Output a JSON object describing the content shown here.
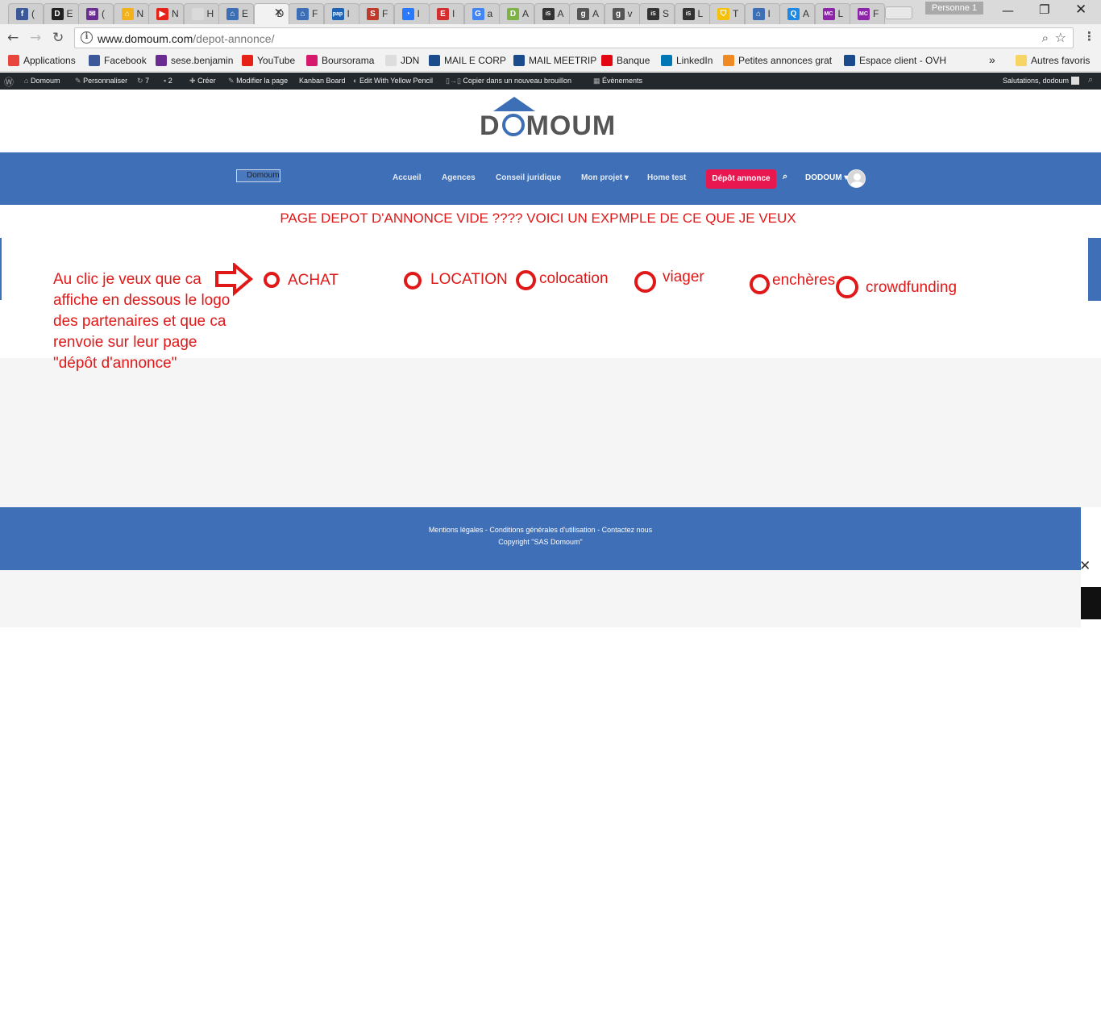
{
  "browser": {
    "tabs": [
      {
        "fav": "f",
        "color": "#3b5998",
        "label": "("
      },
      {
        "fav": "D",
        "color": "#222222",
        "label": "E"
      },
      {
        "fav": "✉",
        "color": "#6a2c91",
        "label": "("
      },
      {
        "fav": "⌂",
        "color": "#f3b21b",
        "label": "N"
      },
      {
        "fav": "▶",
        "color": "#e62117",
        "label": "N"
      },
      {
        "fav": "",
        "color": "#dadada",
        "label": "H"
      },
      {
        "fav": "⌂",
        "color": "#3c6fb6",
        "label": "E"
      },
      {
        "fav": "",
        "color": "#f2f2f2",
        "label": "D"
      },
      {
        "fav": "⌂",
        "color": "#3c6fb6",
        "label": "F"
      },
      {
        "fav": "pap",
        "color": "#1f63b5",
        "label": "I"
      },
      {
        "fav": "S",
        "color": "#c0392b",
        "label": "F"
      },
      {
        "fav": "◔",
        "color": "#2979ff",
        "label": "I"
      },
      {
        "fav": "E",
        "color": "#d32f2f",
        "label": "I"
      },
      {
        "fav": "G",
        "color": "#4285f4",
        "label": "a"
      },
      {
        "fav": "D",
        "color": "#7cb342",
        "label": "A"
      },
      {
        "fav": "iS",
        "color": "#333333",
        "label": "A"
      },
      {
        "fav": "g",
        "color": "#555555",
        "label": "A"
      },
      {
        "fav": "g",
        "color": "#555555",
        "label": "v"
      },
      {
        "fav": "iS",
        "color": "#333333",
        "label": "S"
      },
      {
        "fav": "iS",
        "color": "#333333",
        "label": "L"
      },
      {
        "fav": "⛉",
        "color": "#f4c20d",
        "label": "T"
      },
      {
        "fav": "⌂",
        "color": "#3c6fb6",
        "label": "I"
      },
      {
        "fav": "Q",
        "color": "#1e88e5",
        "label": "A"
      },
      {
        "fav": "MC",
        "color": "#8e24aa",
        "label": "L"
      },
      {
        "fav": "MC",
        "color": "#8e24aa",
        "label": "F"
      }
    ],
    "profile": "Personne 1",
    "url_host": "www.domoum.com",
    "url_path": "/depot-annonce/"
  },
  "bookmarks": [
    {
      "label": "Applications",
      "color": "#e8453c"
    },
    {
      "label": "Facebook",
      "color": "#3b5998"
    },
    {
      "label": "sese.benjamin",
      "color": "#6a2c91"
    },
    {
      "label": "YouTube",
      "color": "#e62117"
    },
    {
      "label": "Boursorama",
      "color": "#d6196b"
    },
    {
      "label": "JDN",
      "color": "#dddddd"
    },
    {
      "label": "MAIL E CORP",
      "color": "#1c4b8c"
    },
    {
      "label": "MAIL MEETRIP",
      "color": "#1c4b8c"
    },
    {
      "label": "Banque",
      "color": "#e30613"
    },
    {
      "label": "LinkedIn",
      "color": "#0077b5"
    },
    {
      "label": "Petites annonces grat",
      "color": "#f08a24"
    },
    {
      "label": "Espace client - OVH",
      "color": "#1c4b8c"
    }
  ],
  "bookmarks_more": "»",
  "bookmarks_other": "Autres favoris",
  "adminbar": {
    "site": "Domoum",
    "customize": "Personnaliser",
    "updates": "7",
    "comments": "2",
    "create": "Créer",
    "edit_page": "Modifier la page",
    "kanban": "Kanban Board",
    "yellow_pencil": "Edit With Yellow Pencil",
    "copy_draft": "Copier dans un nouveau brouillon",
    "events": "Évènements",
    "greeting": "Salutations, dodoum"
  },
  "site": {
    "logo_word_start": "D",
    "logo_word_end": "MOUM",
    "nav_logo_alt": "Domoum",
    "nav": [
      "Accueil",
      "Agences",
      "Conseil juridique",
      "Mon projet ▾",
      "Home test"
    ],
    "cta": "Dépôt annonce",
    "user": "DODOUM ▾"
  },
  "content": {
    "heading": "PAGE DEPOT D'ANNONCE VIDE ???? VOICI UN EXPMPLE DE CE QUE JE VEUX",
    "annotation": "Au clic je veux que ca affiche en dessous le logo des partenaires et que ca renvoie sur leur page \"dépôt d'annonce\"",
    "options": [
      "ACHAT",
      "LOCATION",
      "colocation",
      "viager",
      "enchères",
      "crowdfunding"
    ],
    "annotation_color": "#e01818"
  },
  "footer": {
    "links": "Mentions légales - Conditions générales d'utilisation - Contactez nous",
    "copyright": "Copyright \"SAS Domoum\""
  },
  "colors": {
    "brand_blue": "#3f6fb6",
    "cta_pink": "#e8174f",
    "admin_bar": "#23282d"
  }
}
